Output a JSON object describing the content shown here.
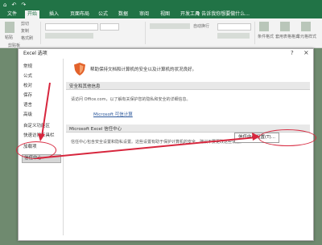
{
  "quick_access": [
    "⌂",
    "↶",
    "↷"
  ],
  "ribbon_tabs": [
    "文件",
    "开始",
    "插入",
    "页面布局",
    "公式",
    "数据",
    "审阅",
    "视图",
    "开发工具"
  ],
  "tell_me": "♀ 告诉我你想要做什么...",
  "ribbon": {
    "paste": "粘贴",
    "cut": "剪切",
    "copy": "复制",
    "format_painter": "格式刷",
    "clipboard": "剪贴板",
    "wrap_text": "自动换行",
    "conditional_format": "条件格式",
    "format_as_table": "套用表格格式",
    "cell_styles": "单元格样式"
  },
  "dialog": {
    "title": "Excel 选项",
    "help": "?",
    "close": "×",
    "nav_items": [
      "常规",
      "公式",
      "校对",
      "保存",
      "语言",
      "高级",
      "自定义功能区",
      "快速访问工具栏",
      "加载项",
      "信任中心"
    ],
    "selected": "信任中心",
    "header": "帮助保持文档和计算机的安全以及计算机的状况良好。",
    "section1": "安全和其他信息",
    "para1": "请访问 Office.com，以了解有关保护您的隐私和安全的详细信息。",
    "link": "Microsoft 可信计算",
    "section2": "Microsoft Excel 信任中心",
    "para2": "信任中心包含安全设置和隐私设置。这些设置有助于保护计算机的安全。建议不要更改这些设置。",
    "trust_button": "信任中心设置(T)..."
  },
  "colors": {
    "excel_green": "#217346",
    "annotation_red": "#d7263d"
  }
}
